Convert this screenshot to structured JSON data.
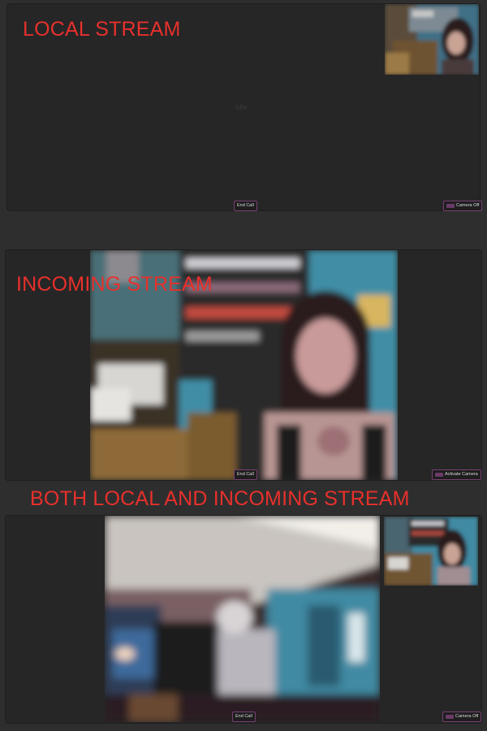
{
  "sections": {
    "local": {
      "caption": "LOCAL STREAM",
      "status_text": "Idle",
      "end_call_label": "End Call",
      "camera_label": "Camera Off",
      "camera_icon": "camera-icon"
    },
    "incoming": {
      "caption": "INCOMING STREAM",
      "end_call_label": "End Call",
      "camera_label": "Activate Camera",
      "camera_icon": "camera-icon"
    },
    "both": {
      "caption": "BOTH LOCAL AND INCOMING STREAM",
      "end_call_label": "End Call",
      "camera_label": "Camera Off",
      "camera_icon": "camera-icon"
    }
  },
  "colors": {
    "caption": "#e8302c",
    "button_border": "#7a3f74",
    "panel_bg": "#262626",
    "page_bg": "#2e2e2e"
  }
}
